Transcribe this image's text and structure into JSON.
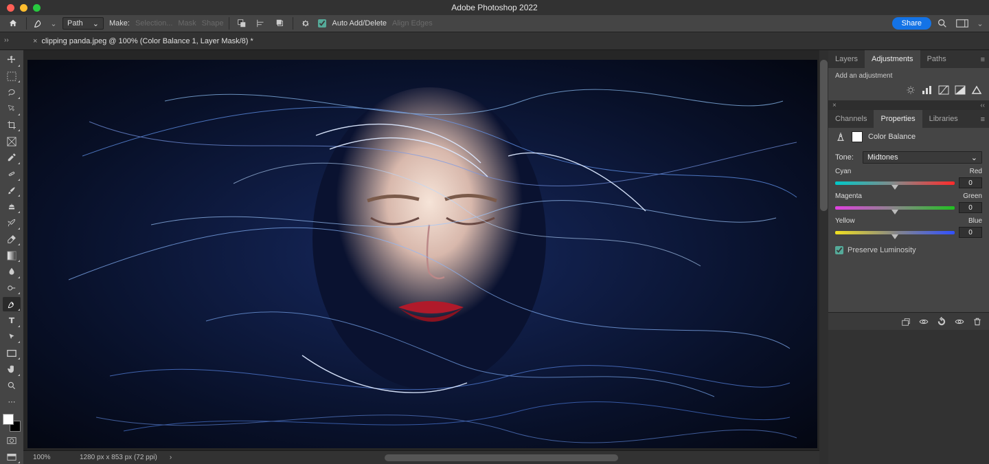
{
  "app_title": "Adobe Photoshop 2022",
  "options_bar": {
    "path_select": "Path",
    "make_label": "Make:",
    "selection_btn": "Selection...",
    "mask_btn": "Mask",
    "shape_btn": "Shape",
    "auto_add_delete": "Auto Add/Delete",
    "align_edges": "Align Edges",
    "share_label": "Share"
  },
  "doc_tab": {
    "title": "clipping panda.jpeg @ 100% (Color Balance 1, Layer Mask/8) *"
  },
  "status": {
    "zoom": "100%",
    "dims": "1280 px x 853 px (72 ppi)"
  },
  "panels": {
    "group1": {
      "tabs": [
        "Layers",
        "Adjustments",
        "Paths"
      ],
      "active": 1,
      "hint": "Add an adjustment"
    },
    "group2": {
      "tabs": [
        "Channels",
        "Properties",
        "Libraries"
      ],
      "active": 1
    }
  },
  "properties": {
    "title": "Color Balance",
    "tone_label": "Tone:",
    "tone_value": "Midtones",
    "sliders": [
      {
        "left": "Cyan",
        "right": "Red",
        "value": "0"
      },
      {
        "left": "Magenta",
        "right": "Green",
        "value": "0"
      },
      {
        "left": "Yellow",
        "right": "Blue",
        "value": "0"
      }
    ],
    "preserve_label": "Preserve Luminosity",
    "preserve_checked": true
  }
}
